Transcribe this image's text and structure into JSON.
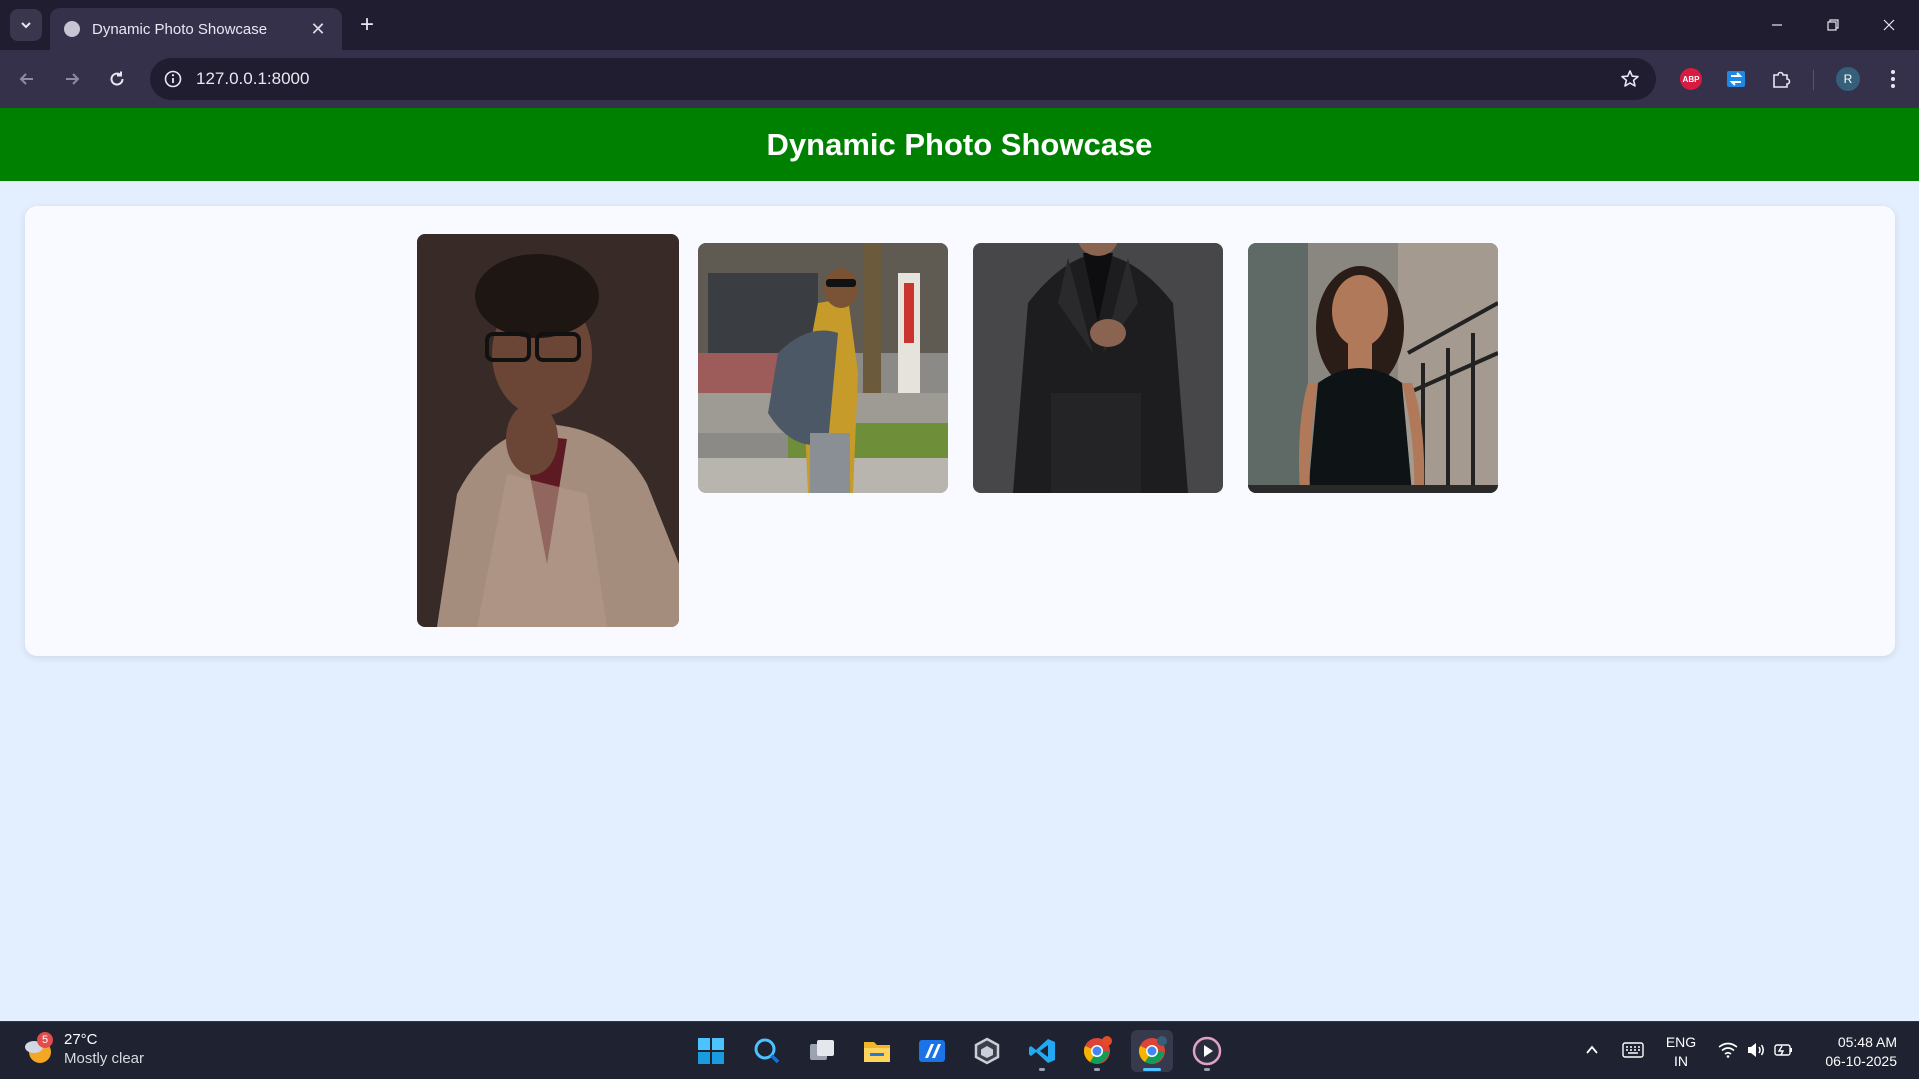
{
  "browser": {
    "tab_title": "Dynamic Photo Showcase",
    "url": "127.0.0.1:8000",
    "profile_initial": "R",
    "abp_label": "ABP"
  },
  "page": {
    "header_title": "Dynamic Photo Showcase",
    "header_color": "#008000"
  },
  "gallery": {
    "photos": [
      {
        "description": "portrait of man with glasses in beige blazer"
      },
      {
        "description": "man with jacket over shoulder on street"
      },
      {
        "description": "man in black suit"
      },
      {
        "description": "smiling woman in black top"
      }
    ]
  },
  "taskbar": {
    "weather_badge": "5",
    "temperature": "27°C",
    "weather_desc": "Mostly clear",
    "lang_line1": "ENG",
    "lang_line2": "IN",
    "time": "05:48 AM",
    "date": "06-10-2025",
    "apps": [
      "start",
      "search",
      "task-view",
      "file-explorer",
      "azure-tool",
      "unity",
      "vscode",
      "chrome",
      "chrome-active",
      "media-player"
    ]
  }
}
